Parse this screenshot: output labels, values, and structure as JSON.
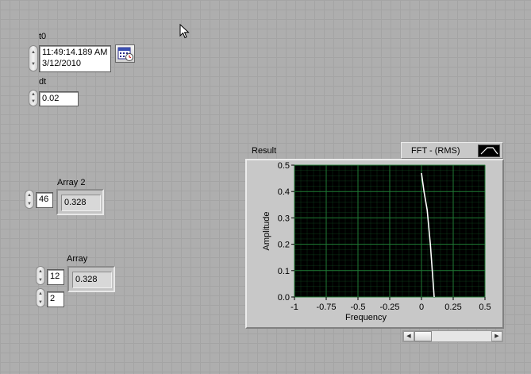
{
  "t0": {
    "label": "t0",
    "time": "11:49:14.189 AM",
    "date": "3/12/2010",
    "calendar_icon": "calendar-clock-icon"
  },
  "dt": {
    "label": "dt",
    "value": "0.02"
  },
  "array2": {
    "label": "Array 2",
    "index": "46",
    "value": "0.328"
  },
  "array": {
    "label": "Array",
    "index_row": "12",
    "index_col": "2",
    "value": "0.328"
  },
  "graph": {
    "label": "Result",
    "legend_label": "FFT - (RMS)",
    "plot_background": "#000000",
    "grid_color": "#1f7a35",
    "trace_color": "#ffffff"
  },
  "chart_data": {
    "type": "line",
    "title": "Result",
    "xlabel": "Frequency",
    "ylabel": "Amplitude",
    "xlim": [
      -1,
      0.5
    ],
    "ylim": [
      0,
      0.5
    ],
    "x_ticks": [
      "-1",
      "-0.75",
      "-0.5",
      "-0.25",
      "0",
      "0.25",
      "0.5"
    ],
    "y_ticks": [
      "0.0",
      "0.1",
      "0.2",
      "0.3",
      "0.4",
      "0.5"
    ],
    "grid": true,
    "legend": "top-right",
    "series": [
      {
        "name": "FFT - (RMS)",
        "x": [
          0.0,
          0.02,
          0.045,
          0.07,
          0.085,
          0.1
        ],
        "y": [
          0.47,
          0.4,
          0.33,
          0.2,
          0.1,
          0.0
        ]
      }
    ]
  }
}
